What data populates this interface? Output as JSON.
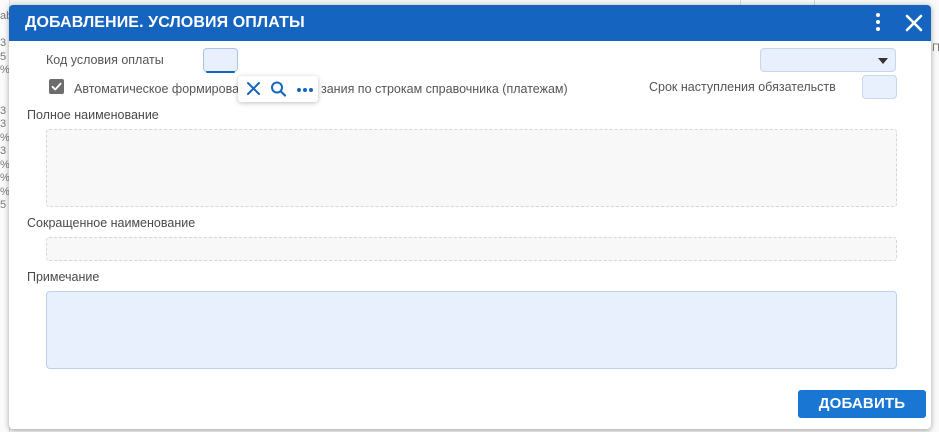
{
  "background": {
    "left_fragments": [
      "ab",
      "",
      "3",
      "5",
      "%",
      "",
      "",
      "3",
      "3",
      "%",
      "3",
      "%",
      "%",
      "%",
      "5"
    ],
    "right_fragment": "П"
  },
  "dialog": {
    "title": "ДОБАВЛЕНИЕ. УСЛОВИЯ ОПЛАТЫ",
    "menu_icon": "kebab-menu-icon",
    "close_icon": "close-icon",
    "accent_color": "#1565c0"
  },
  "form": {
    "code_label": "Код условия оплаты",
    "code_value": "",
    "select_value": "",
    "auto_checkbox": {
      "checked": true,
      "label_part1": "Автоматическое формирова",
      "label_part2": "зания по строкам справочника (платежам)"
    },
    "term_label": "Срок наступления обязательств",
    "term_value": "",
    "full_name_label": "Полное наименование",
    "full_name_value": "",
    "short_name_label": "Сокращенное наименование",
    "short_name_value": "",
    "note_label": "Примечание",
    "note_value": ""
  },
  "field_popup": {
    "icons": [
      "clear-icon",
      "search-icon",
      "more-icon"
    ]
  },
  "actions": {
    "add_label": "ДОБАВИТЬ"
  }
}
